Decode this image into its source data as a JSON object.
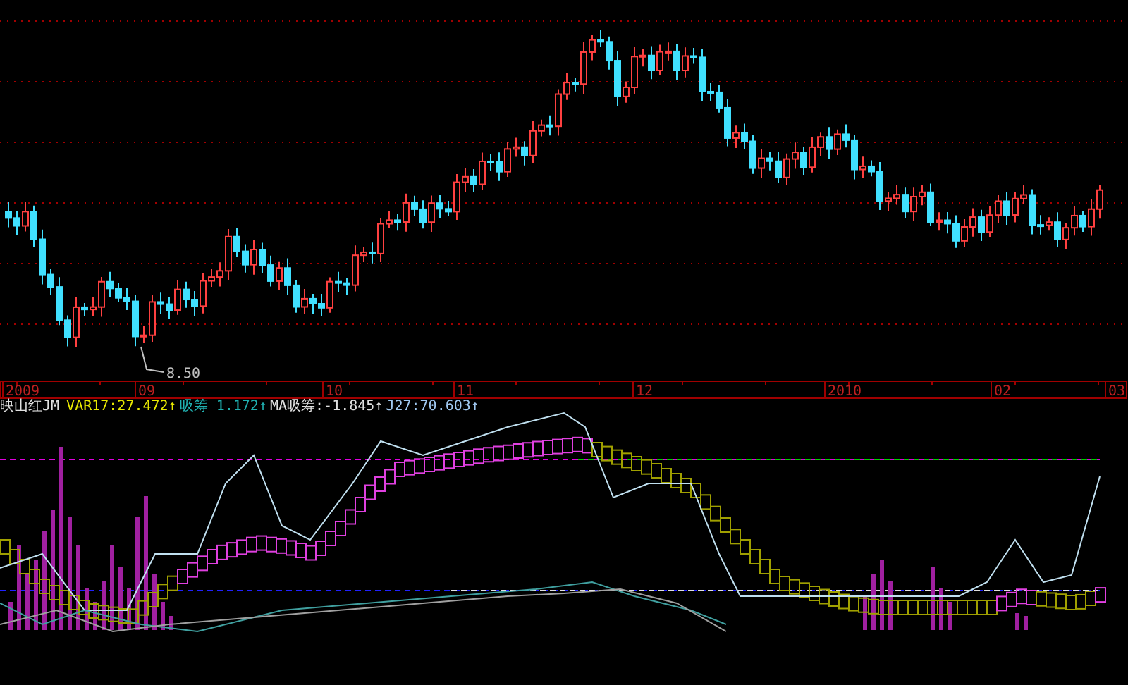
{
  "price_chart": {
    "low_label": "8.50"
  },
  "time_axis": {
    "labels": [
      "2009",
      "09",
      "10",
      "11",
      "12",
      "2010",
      "02",
      "03"
    ]
  },
  "indicator": {
    "name": "映山红JM",
    "legend": [
      {
        "text": "VAR17:27.472",
        "arrow": "↑",
        "color": "#e8e800"
      },
      {
        "text": "吸筹 1.172",
        "arrow": "↑",
        "color": "#20b0b0"
      },
      {
        "text": "MA吸筹:-1.845",
        "arrow": "↑",
        "color": "#e0e0e0"
      },
      {
        "text": "J27:70.603",
        "arrow": "↑",
        "color": "#a0c8f0"
      }
    ]
  }
}
